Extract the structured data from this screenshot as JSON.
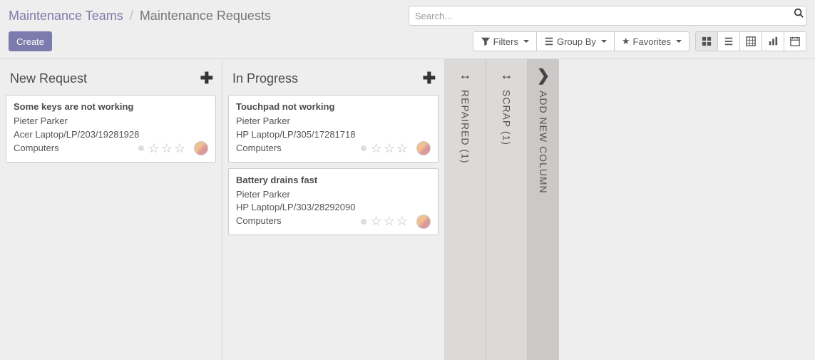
{
  "breadcrumb": {
    "parent": "Maintenance Teams",
    "sep": "/",
    "current": "Maintenance Requests"
  },
  "create_label": "Create",
  "search": {
    "placeholder": "Search..."
  },
  "toolbar": {
    "filters_label": "Filters",
    "groupby_label": "Group By",
    "favorites_label": "Favorites"
  },
  "columns": [
    {
      "title": "New Request",
      "cards": [
        {
          "title": "Some keys are not working",
          "person": "Pieter Parker",
          "asset": "Acer Laptop/LP/203/19281928",
          "category": "Computers"
        }
      ]
    },
    {
      "title": "In Progress",
      "cards": [
        {
          "title": "Touchpad not working",
          "person": "Pieter Parker",
          "asset": "HP Laptop/LP/305/17281718",
          "category": "Computers"
        },
        {
          "title": "Battery drains fast",
          "person": "Pieter Parker",
          "asset": "HP Laptop/LP/303/28292090",
          "category": "Computers"
        }
      ]
    }
  ],
  "folded": [
    {
      "label": "REPAIRED (1)"
    },
    {
      "label": "SCRAP (1)"
    }
  ],
  "add_column_label": "ADD NEW COLUMN"
}
